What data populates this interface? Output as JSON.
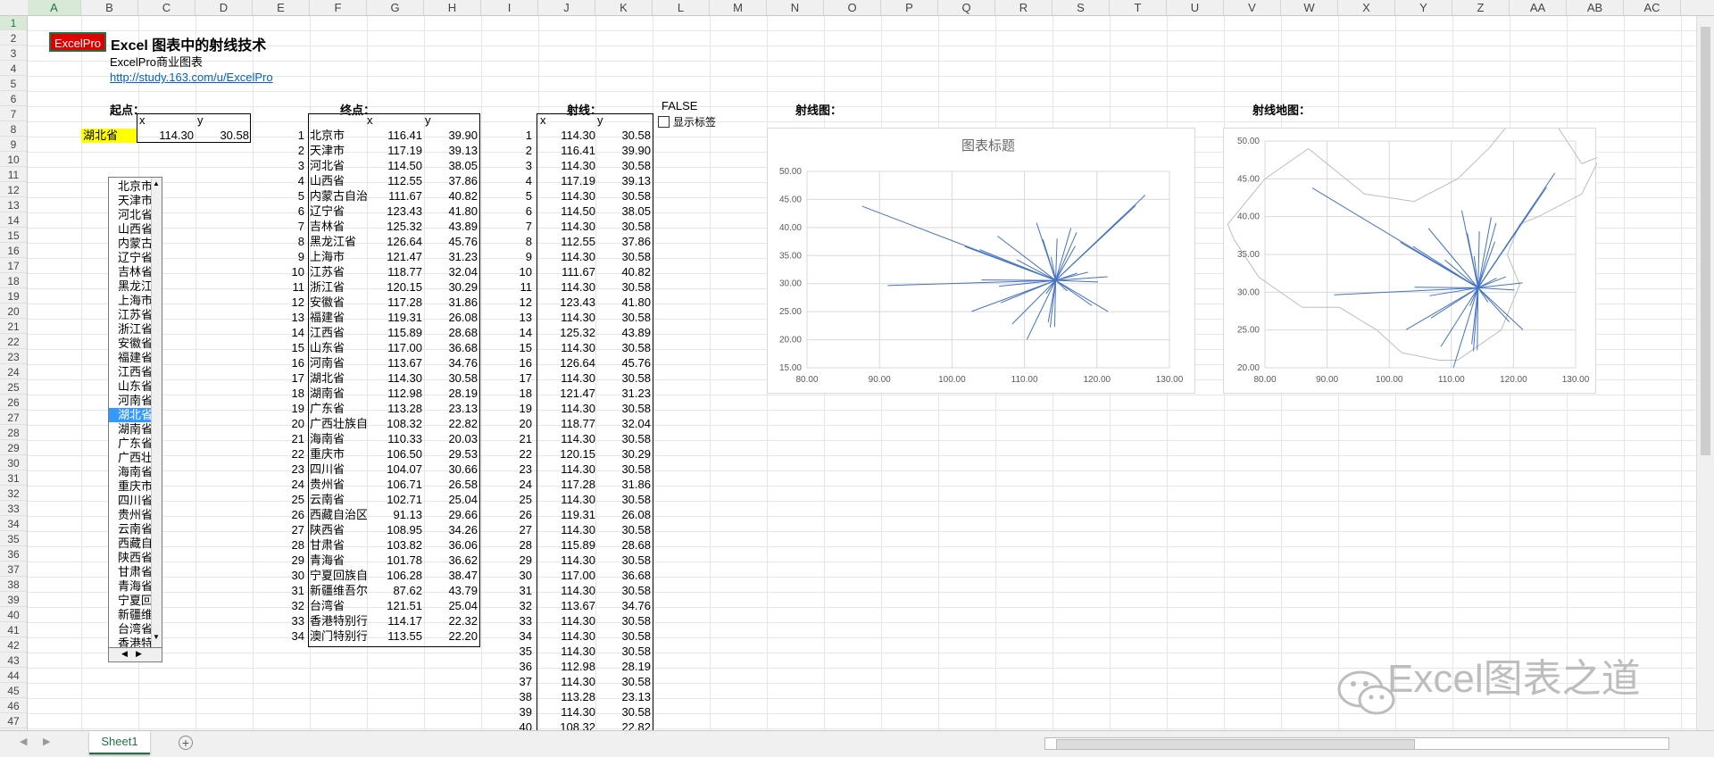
{
  "columns": [
    "A",
    "B",
    "C",
    "D",
    "E",
    "F",
    "G",
    "H",
    "I",
    "J",
    "K",
    "L",
    "M",
    "N",
    "O",
    "P",
    "Q",
    "R",
    "S",
    "T",
    "U",
    "V",
    "W",
    "X",
    "Y",
    "Z",
    "AA",
    "AB",
    "AC"
  ],
  "rows": [
    "1",
    "2",
    "3",
    "4",
    "5",
    "6",
    "7",
    "8",
    "9",
    "10",
    "11",
    "12",
    "13",
    "14",
    "15",
    "16",
    "17",
    "18",
    "19",
    "20",
    "21",
    "22",
    "23",
    "24",
    "25",
    "26",
    "27",
    "28",
    "29",
    "30",
    "31",
    "32",
    "33",
    "34",
    "35",
    "36",
    "37",
    "38",
    "39",
    "40",
    "41",
    "42",
    "43",
    "44",
    "45",
    "46",
    "47"
  ],
  "header": {
    "brand": "ExcelPro",
    "title": "Excel 图表中的射线技术",
    "subtitle": "ExcelPro商业图表",
    "link": "http://study.163.com/u/ExcelPro"
  },
  "sections": {
    "start": "起点：",
    "end": "终点：",
    "ray": "射线：",
    "ray_chart": "射线图：",
    "ray_map": "射线地图："
  },
  "start": {
    "x_label": "x",
    "y_label": "y",
    "name": "湖北省",
    "x": "114.30",
    "y": "30.58"
  },
  "flag": "FALSE",
  "checkbox_label": "显示标签",
  "end_headers": {
    "x": "x",
    "y": "y"
  },
  "end_points": [
    [
      "1",
      "北京市",
      "116.41",
      "39.90"
    ],
    [
      "2",
      "天津市",
      "117.19",
      "39.13"
    ],
    [
      "3",
      "河北省",
      "114.50",
      "38.05"
    ],
    [
      "4",
      "山西省",
      "112.55",
      "37.86"
    ],
    [
      "5",
      "内蒙古自治",
      "111.67",
      "40.82"
    ],
    [
      "6",
      "辽宁省",
      "123.43",
      "41.80"
    ],
    [
      "7",
      "吉林省",
      "125.32",
      "43.89"
    ],
    [
      "8",
      "黑龙江省",
      "126.64",
      "45.76"
    ],
    [
      "9",
      "上海市",
      "121.47",
      "31.23"
    ],
    [
      "10",
      "江苏省",
      "118.77",
      "32.04"
    ],
    [
      "11",
      "浙江省",
      "120.15",
      "30.29"
    ],
    [
      "12",
      "安徽省",
      "117.28",
      "31.86"
    ],
    [
      "13",
      "福建省",
      "119.31",
      "26.08"
    ],
    [
      "14",
      "江西省",
      "115.89",
      "28.68"
    ],
    [
      "15",
      "山东省",
      "117.00",
      "36.68"
    ],
    [
      "16",
      "河南省",
      "113.67",
      "34.76"
    ],
    [
      "17",
      "湖北省",
      "114.30",
      "30.58"
    ],
    [
      "18",
      "湖南省",
      "112.98",
      "28.19"
    ],
    [
      "19",
      "广东省",
      "113.28",
      "23.13"
    ],
    [
      "20",
      "广西壮族自",
      "108.32",
      "22.82"
    ],
    [
      "21",
      "海南省",
      "110.33",
      "20.03"
    ],
    [
      "22",
      "重庆市",
      "106.50",
      "29.53"
    ],
    [
      "23",
      "四川省",
      "104.07",
      "30.66"
    ],
    [
      "24",
      "贵州省",
      "106.71",
      "26.58"
    ],
    [
      "25",
      "云南省",
      "102.71",
      "25.04"
    ],
    [
      "26",
      "西藏自治区",
      "91.13",
      "29.66"
    ],
    [
      "27",
      "陕西省",
      "108.95",
      "34.26"
    ],
    [
      "28",
      "甘肃省",
      "103.82",
      "36.06"
    ],
    [
      "29",
      "青海省",
      "101.78",
      "36.62"
    ],
    [
      "30",
      "宁夏回族自",
      "106.28",
      "38.47"
    ],
    [
      "31",
      "新疆维吾尔",
      "87.62",
      "43.79"
    ],
    [
      "32",
      "台湾省",
      "121.51",
      "25.04"
    ],
    [
      "33",
      "香港特别行",
      "114.17",
      "22.32"
    ],
    [
      "34",
      "澳门特别行",
      "113.55",
      "22.20"
    ]
  ],
  "ray_headers": {
    "x": "x",
    "y": "y"
  },
  "ray_rows": [
    [
      "1",
      "114.30",
      "30.58"
    ],
    [
      "2",
      "116.41",
      "39.90"
    ],
    [
      "3",
      "114.30",
      "30.58"
    ],
    [
      "4",
      "117.19",
      "39.13"
    ],
    [
      "5",
      "114.30",
      "30.58"
    ],
    [
      "6",
      "114.50",
      "38.05"
    ],
    [
      "7",
      "114.30",
      "30.58"
    ],
    [
      "8",
      "112.55",
      "37.86"
    ],
    [
      "9",
      "114.30",
      "30.58"
    ],
    [
      "10",
      "111.67",
      "40.82"
    ],
    [
      "11",
      "114.30",
      "30.58"
    ],
    [
      "12",
      "123.43",
      "41.80"
    ],
    [
      "13",
      "114.30",
      "30.58"
    ],
    [
      "14",
      "125.32",
      "43.89"
    ],
    [
      "15",
      "114.30",
      "30.58"
    ],
    [
      "16",
      "126.64",
      "45.76"
    ],
    [
      "17",
      "114.30",
      "30.58"
    ],
    [
      "18",
      "121.47",
      "31.23"
    ],
    [
      "19",
      "114.30",
      "30.58"
    ],
    [
      "20",
      "118.77",
      "32.04"
    ],
    [
      "21",
      "114.30",
      "30.58"
    ],
    [
      "22",
      "120.15",
      "30.29"
    ],
    [
      "23",
      "114.30",
      "30.58"
    ],
    [
      "24",
      "117.28",
      "31.86"
    ],
    [
      "25",
      "114.30",
      "30.58"
    ],
    [
      "26",
      "119.31",
      "26.08"
    ],
    [
      "27",
      "114.30",
      "30.58"
    ],
    [
      "28",
      "115.89",
      "28.68"
    ],
    [
      "29",
      "114.30",
      "30.58"
    ],
    [
      "30",
      "117.00",
      "36.68"
    ],
    [
      "31",
      "114.30",
      "30.58"
    ],
    [
      "32",
      "113.67",
      "34.76"
    ],
    [
      "33",
      "114.30",
      "30.58"
    ],
    [
      "34",
      "114.30",
      "30.58"
    ],
    [
      "35",
      "114.30",
      "30.58"
    ],
    [
      "36",
      "112.98",
      "28.19"
    ],
    [
      "37",
      "114.30",
      "30.58"
    ],
    [
      "38",
      "113.28",
      "23.13"
    ],
    [
      "39",
      "114.30",
      "30.58"
    ],
    [
      "40",
      "108.32",
      "22.82"
    ]
  ],
  "listbox_items": [
    "北京市",
    "天津市",
    "河北省",
    "山西省",
    "内蒙古",
    "辽宁省",
    "吉林省",
    "黑龙江",
    "上海市",
    "江苏省",
    "浙江省",
    "安徽省",
    "福建省",
    "江西省",
    "山东省",
    "河南省",
    "湖北省",
    "湖南省",
    "广东省",
    "广西壮",
    "海南省",
    "重庆市",
    "四川省",
    "贵州省",
    "云南省",
    "西藏自",
    "陕西省",
    "甘肃省",
    "青海省",
    "宁夏回",
    "新疆维",
    "台湾省",
    "香港特"
  ],
  "listbox_selected": "湖北省",
  "sheet_tab": "Sheet1",
  "watermark": "Excel图表之道",
  "colors": {
    "accent": "#217346",
    "brand": "#e00000",
    "highlight": "#ffff00",
    "line": "#4472c4",
    "selection": "#3399ff"
  },
  "chart_data": [
    {
      "type": "line",
      "title": "图表标题",
      "xlim": [
        80,
        130
      ],
      "ylim": [
        15,
        50
      ],
      "xticks": [
        "80.00",
        "90.00",
        "100.00",
        "110.00",
        "120.00",
        "130.00"
      ],
      "yticks": [
        "15.00",
        "20.00",
        "25.00",
        "30.00",
        "35.00",
        "40.00",
        "45.00",
        "50.00"
      ],
      "grid": true,
      "origin": [
        114.3,
        30.58
      ],
      "endpoints": [
        [
          116.41,
          39.9
        ],
        [
          117.19,
          39.13
        ],
        [
          114.5,
          38.05
        ],
        [
          112.55,
          37.86
        ],
        [
          111.67,
          40.82
        ],
        [
          123.43,
          41.8
        ],
        [
          125.32,
          43.89
        ],
        [
          126.64,
          45.76
        ],
        [
          121.47,
          31.23
        ],
        [
          118.77,
          32.04
        ],
        [
          120.15,
          30.29
        ],
        [
          117.28,
          31.86
        ],
        [
          119.31,
          26.08
        ],
        [
          115.89,
          28.68
        ],
        [
          117.0,
          36.68
        ],
        [
          113.67,
          34.76
        ],
        [
          114.3,
          30.58
        ],
        [
          112.98,
          28.19
        ],
        [
          113.28,
          23.13
        ],
        [
          108.32,
          22.82
        ],
        [
          110.33,
          20.03
        ],
        [
          106.5,
          29.53
        ],
        [
          104.07,
          30.66
        ],
        [
          106.71,
          26.58
        ],
        [
          102.71,
          25.04
        ],
        [
          91.13,
          29.66
        ],
        [
          108.95,
          34.26
        ],
        [
          103.82,
          36.06
        ],
        [
          101.78,
          36.62
        ],
        [
          106.28,
          38.47
        ],
        [
          87.62,
          43.79
        ],
        [
          121.51,
          25.04
        ],
        [
          114.17,
          22.32
        ],
        [
          113.55,
          22.2
        ]
      ]
    },
    {
      "type": "line",
      "title": "",
      "xlim": [
        80,
        130
      ],
      "ylim": [
        20,
        50
      ],
      "xticks": [
        "80.00",
        "90.00",
        "100.00",
        "110.00",
        "120.00",
        "130.00"
      ],
      "yticks": [
        "20.00",
        "25.00",
        "30.00",
        "35.00",
        "40.00",
        "45.00",
        "50.00"
      ],
      "grid": true,
      "origin": [
        114.3,
        30.58
      ],
      "endpoints": [
        [
          116.41,
          39.9
        ],
        [
          117.19,
          39.13
        ],
        [
          114.5,
          38.05
        ],
        [
          112.55,
          37.86
        ],
        [
          111.67,
          40.82
        ],
        [
          123.43,
          41.8
        ],
        [
          125.32,
          43.89
        ],
        [
          126.64,
          45.76
        ],
        [
          121.47,
          31.23
        ],
        [
          118.77,
          32.04
        ],
        [
          120.15,
          30.29
        ],
        [
          117.28,
          31.86
        ],
        [
          119.31,
          26.08
        ],
        [
          115.89,
          28.68
        ],
        [
          117.0,
          36.68
        ],
        [
          113.67,
          34.76
        ],
        [
          114.3,
          30.58
        ],
        [
          112.98,
          28.19
        ],
        [
          113.28,
          23.13
        ],
        [
          108.32,
          22.82
        ],
        [
          110.33,
          20.03
        ],
        [
          106.5,
          29.53
        ],
        [
          104.07,
          30.66
        ],
        [
          106.71,
          26.58
        ],
        [
          102.71,
          25.04
        ],
        [
          91.13,
          29.66
        ],
        [
          108.95,
          34.26
        ],
        [
          103.82,
          36.06
        ],
        [
          101.78,
          36.62
        ],
        [
          106.28,
          38.47
        ],
        [
          87.62,
          43.79
        ],
        [
          121.51,
          25.04
        ],
        [
          114.17,
          22.32
        ],
        [
          113.55,
          22.2
        ]
      ]
    }
  ]
}
